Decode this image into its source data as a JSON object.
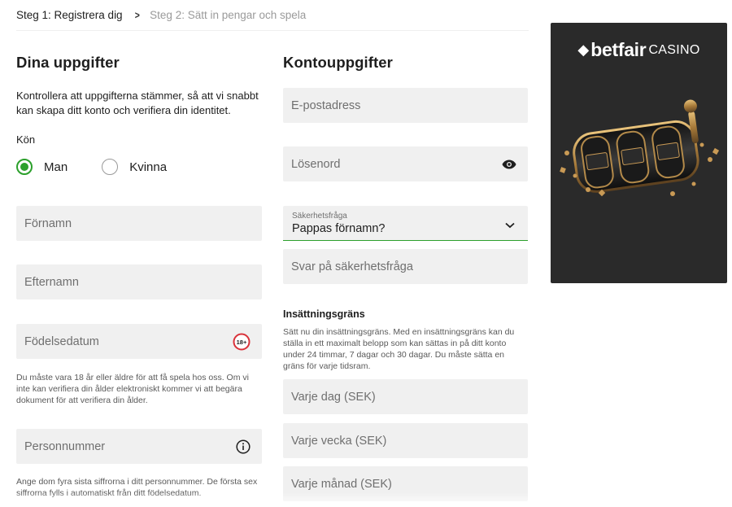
{
  "steps": {
    "step1": "Steg 1: Registrera dig",
    "step2": "Steg 2: Sätt in pengar och spela"
  },
  "personal": {
    "heading": "Dina uppgifter",
    "intro": "Kontrollera att uppgifterna stämmer, så att vi snabbt kan skapa ditt konto och verifiera din identitet.",
    "gender_label": "Kön",
    "gender_options": [
      "Man",
      "Kvinna"
    ],
    "gender_selected": "Man",
    "first_name_placeholder": "Förnamn",
    "last_name_placeholder": "Efternamn",
    "dob_placeholder": "Födelsedatum",
    "age_badge": "18+",
    "age_note": "Du måste vara 18 år eller äldre för att få spela hos oss. Om vi inte kan verifiera din ålder elektroniskt kommer vi att begära dokument för att verifiera din ålder.",
    "personal_number_placeholder": "Personnummer",
    "personal_number_note": "Ange dom fyra sista siffrorna i ditt personnummer. De första sex siffrorna fylls i automatiskt från ditt födelsedatum."
  },
  "account": {
    "heading": "Kontouppgifter",
    "email_placeholder": "E-postadress",
    "password_placeholder": "Lösenord",
    "security_question_label": "Säkerhetsfråga",
    "security_question_value": "Pappas förnamn?",
    "security_answer_placeholder": "Svar på säkerhetsfråga",
    "deposit_limit_title": "Insättningsgräns",
    "deposit_limit_text": "Sätt nu din insättningsgräns. Med en insättningsgräns kan du ställa in ett maximalt belopp som kan sättas in på ditt konto under 24 timmar, 7 dagar och 30 dagar. Du måste sätta en gräns för varje tidsram.",
    "daily_placeholder": "Varje dag (SEK)",
    "weekly_placeholder": "Varje vecka (SEK)",
    "monthly_placeholder": "Varje månad (SEK)"
  },
  "promo": {
    "brand": "betfair",
    "brand_sub": "CASINO"
  },
  "icons": {
    "step_chevron": "chevron-right-icon",
    "password_toggle": "eye-icon",
    "select_arrow": "chevron-down-icon",
    "info": "info-icon"
  },
  "colors": {
    "accent_green": "#2ca02c",
    "field_bg": "#f0f0f0",
    "age_badge_red": "#d9323a",
    "promo_bg": "#2a2a2a"
  }
}
